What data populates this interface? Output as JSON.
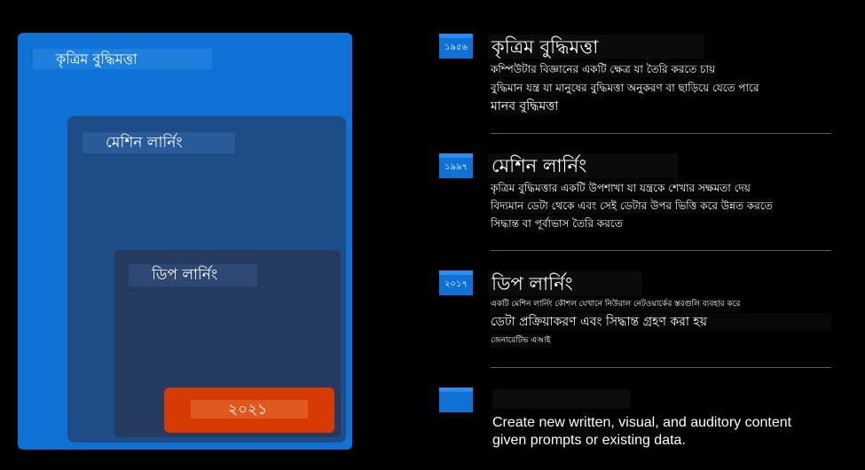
{
  "diagram": {
    "ai_label": "কৃত্রিম বুদ্ধিমত্তা",
    "ml_label": "মেশিন লার্নিং",
    "dl_label": "ডিপ লার্নিং",
    "gen_label": "২০২১"
  },
  "timeline": [
    {
      "year": "১৯৫৬",
      "title": "কৃত্রিম বুদ্ধিমত্তা",
      "lines": [
        "কম্পিউটার বিজ্ঞানের একটি ক্ষেত্র যা তৈরি করতে চায়",
        "বুদ্ধিমান যন্ত্র যা মানুষের বুদ্ধিমত্তা অনুকরণ বা ছাড়িয়ে যেতে পারে",
        "মানব বুদ্ধিমত্তা"
      ]
    },
    {
      "year": "১৯৯৭",
      "title": "মেশিন লার্নিং",
      "lines": [
        "কৃত্রিম বুদ্ধিমত্তার একটি উপশাখা যা যন্ত্রকে শেখার সক্ষমতা দেয়",
        "বিদ্যমান ডেটা থেকে এবং সেই ডেটার উপর ভিত্তি করে উন্নত করতে",
        "সিদ্ধান্ত বা পূর্বাভাস তৈরি করতে"
      ]
    },
    {
      "year": "২০১৭",
      "title": "ডিপ লার্নিং",
      "lines": [
        "একটি মেশিন লার্নিং কৌশল যেখানে নিউরাল নেটওয়ার্কের স্তরগুলি ব্যবহার করে",
        "ডেটা প্রক্রিয়াকরণ এবং সিদ্ধান্ত গ্রহণ করা হয়",
        "জেনারেটিভ এআই"
      ]
    },
    {
      "year": "",
      "title": "",
      "lines": [
        "Create new written, visual, and auditory content",
        "given prompts or existing data."
      ]
    }
  ],
  "colors": {
    "ai_box": "#0f71d4",
    "ml_box": "#1d4c87",
    "dl_box": "#243a60",
    "gen_box": "#d63b03",
    "year_badge": "#0f71d4"
  }
}
